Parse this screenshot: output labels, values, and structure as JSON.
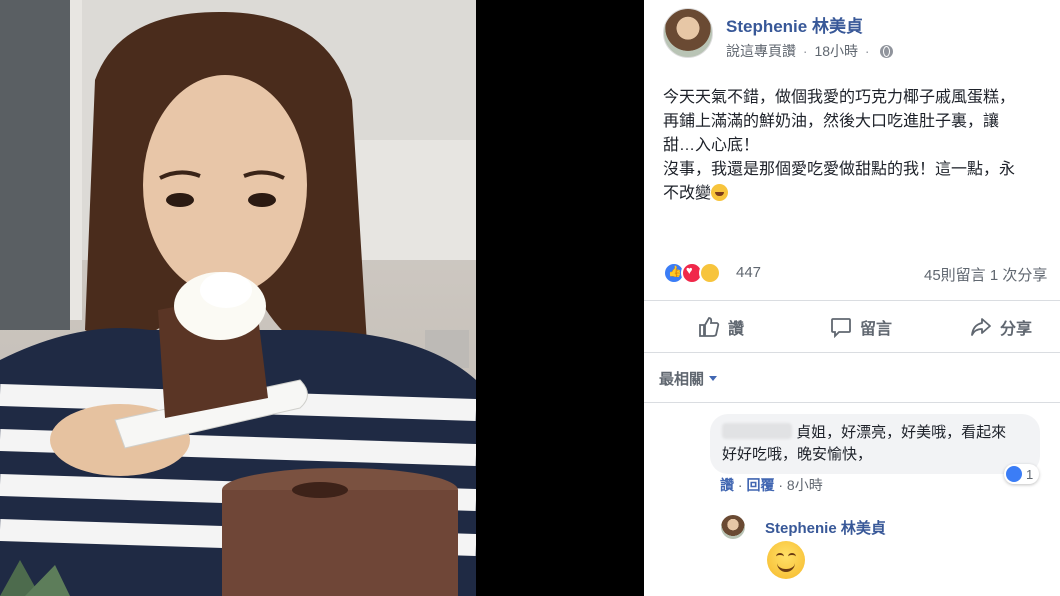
{
  "post": {
    "author": "Stephenie 林美貞",
    "meta_like": "說這專頁讚",
    "meta_sep": "·",
    "meta_time": "18小時",
    "meta_sep2": "·",
    "text_line1": "今天天氣不錯，做個我愛的巧克力椰子戚風蛋糕，",
    "text_line2": "再鋪上滿滿的鮮奶油，然後大口吃進肚子裏，讓",
    "text_line3": "甜…入心底！",
    "text_line4": "沒事，我還是那個愛吃愛做甜點的我！這一點，永",
    "text_line5": "不改變",
    "reaction_count": "447",
    "comments_shares": "45則留言  1 次分享"
  },
  "actions": {
    "like_label": "讚",
    "comment_label": "留言",
    "share_label": "分享"
  },
  "comments": {
    "filter_label": "最相關",
    "first_comment_line1": "貞姐，好漂亮，好美哦，看起來",
    "first_comment_line2": "好好吃哦，晚安愉快，",
    "first_comment_likes": "1",
    "first_like_action": "讚",
    "first_sep": "·",
    "first_reply_action": "回覆",
    "first_sep2": "·",
    "first_time": "8小時",
    "reply_author": "Stephenie 林美貞"
  },
  "colors": {
    "link_blue": "#385898",
    "text_gray": "#606770",
    "like_blue": "#3b7df6",
    "love_red": "#f0284a",
    "haha_yellow": "#f7c43c"
  },
  "icons": [
    "globe-icon",
    "like-reaction-icon",
    "love-reaction-icon",
    "haha-reaction-icon",
    "thumbs-up-icon",
    "comment-icon",
    "share-icon",
    "smile-emoji-icon"
  ]
}
